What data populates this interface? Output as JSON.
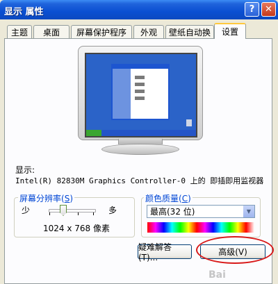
{
  "window": {
    "title": "显示 属性",
    "help_glyph": "?",
    "close_glyph": "✕"
  },
  "tabs": [
    {
      "label": "主题"
    },
    {
      "label": "桌面"
    },
    {
      "label": "屏幕保护程序"
    },
    {
      "label": "外观"
    },
    {
      "label": "壁纸自动换"
    },
    {
      "label": "设置",
      "active": true
    }
  ],
  "display": {
    "label": "显示:",
    "device": "Intel(R) 82830M Graphics Controller-0 上的 即插即用监视器"
  },
  "resolution": {
    "group_label": "屏幕分辨率",
    "mnemonic": "S",
    "min_label": "少",
    "max_label": "多",
    "value_text": "1024 x 768 像素",
    "slider_level": 0.33
  },
  "color_quality": {
    "group_label": "颜色质量",
    "mnemonic": "C",
    "selected": "最高(32 位)",
    "dropdown_glyph": "▼"
  },
  "buttons": {
    "troubleshoot": "疑难解答(T)...",
    "advanced": "高级(V)"
  },
  "watermark": "Bai"
}
